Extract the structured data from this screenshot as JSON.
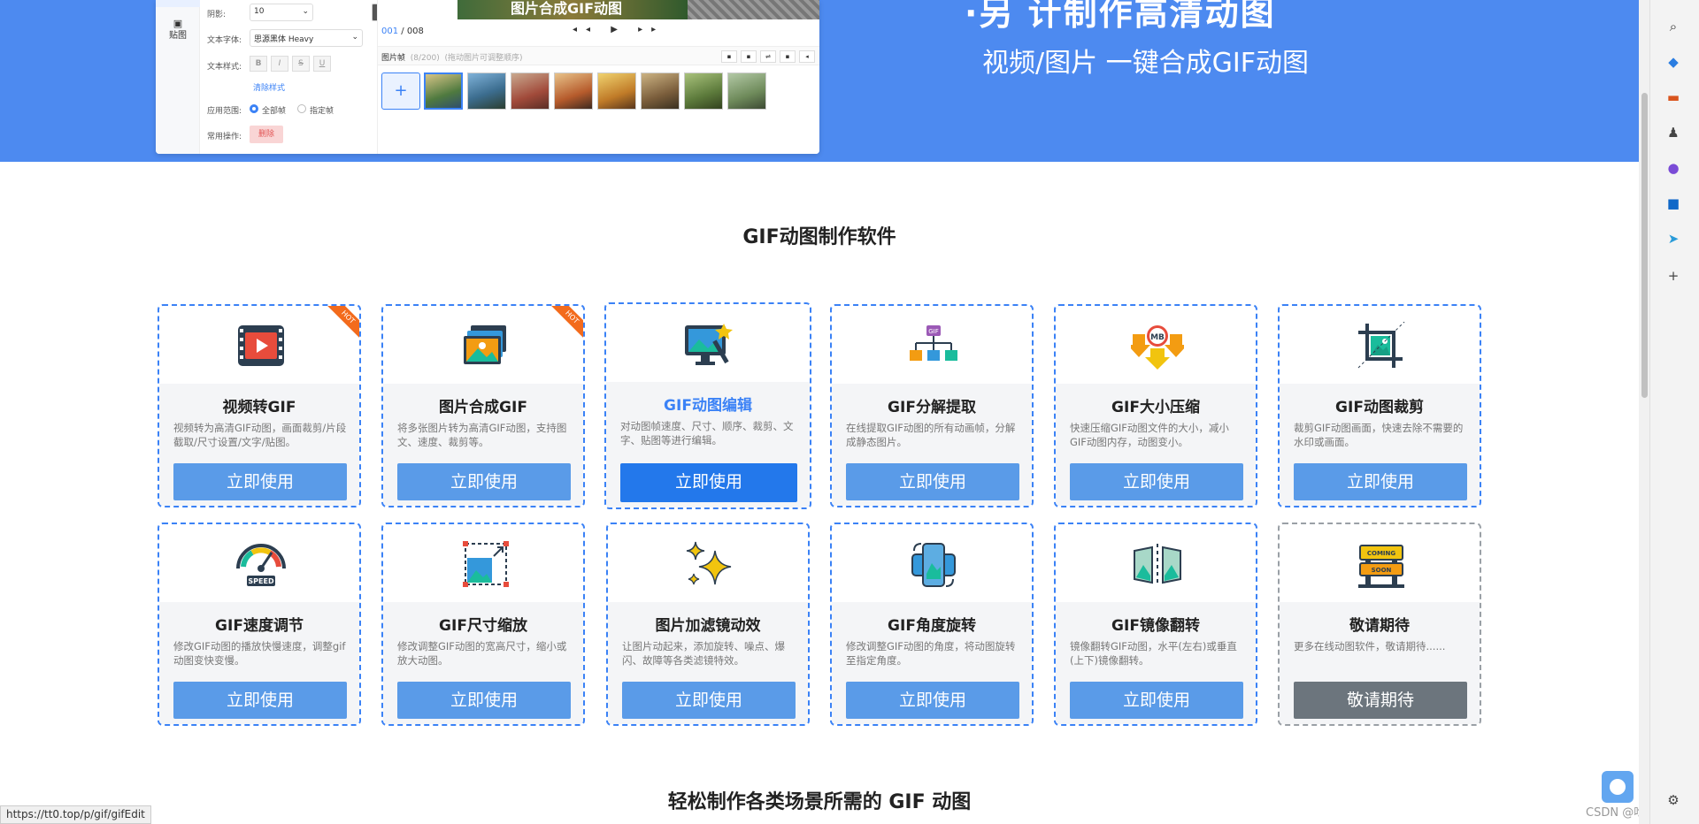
{
  "hero": {
    "title": "·另 计制作高清动图",
    "subtitle": "视频/图片 一键合成GIF动图"
  },
  "editor": {
    "tab_label": "贴图",
    "shadow_label": "阴影:",
    "shadow_value": "10",
    "font_label": "文本字体:",
    "font_value": "思源黑体 Heavy",
    "style_label": "文本样式:",
    "style_buttons": [
      "B",
      "I",
      "S",
      "U"
    ],
    "clear_style": "清除样式",
    "range_label": "应用范围:",
    "range_all": "全部帧",
    "range_some": "指定帧",
    "ops_label": "常用操作:",
    "delete_label": "删除",
    "image_caption": "图片合成GIF动图",
    "frame_current": "001",
    "frame_total": " / 008",
    "controls": "◂◂ ▶ ▸▸",
    "frames_label": "图片帧",
    "frames_count": "(8/200)",
    "frames_hint": "(拖动图片可调整顺序)",
    "add": "+"
  },
  "section1": {
    "title": "GIF动图制作软件"
  },
  "cards": [
    {
      "name": "视频转GIF",
      "desc": "视频转为高清GIF动图，画面裁剪/片段截取/尺寸设置/文字/贴图。",
      "button": "立即使用",
      "badge": "HOT",
      "icon": "video-film-icon"
    },
    {
      "name": "图片合成GIF",
      "desc": "将多张图片转为高清GIF动图，支持图文、速度、裁剪等。",
      "button": "立即使用",
      "badge": "HOT",
      "icon": "photo-stack-icon"
    },
    {
      "name": "GIF动图编辑",
      "desc": "对动图帧速度、尺寸、顺序、裁剪、文字、贴图等进行编辑。",
      "button": "立即使用",
      "badge": "",
      "icon": "monitor-edit-icon"
    },
    {
      "name": "GIF分解提取",
      "desc": "在线提取GIF动图的所有动画帧，分解成静态图片。",
      "button": "立即使用",
      "badge": "",
      "icon": "gif-tree-icon"
    },
    {
      "name": "GIF大小压缩",
      "desc": "快速压缩GIF动图文件的大小，减小GIF动图内存，动图变小。",
      "button": "立即使用",
      "badge": "",
      "icon": "mb-compress-icon"
    },
    {
      "name": "GIF动图裁剪",
      "desc": "裁剪GIF动图画面，快速去除不需要的水印或画面。",
      "button": "立即使用",
      "badge": "",
      "icon": "crop-icon"
    },
    {
      "name": "GIF速度调节",
      "desc": "修改GIF动图的播放快慢速度，调整gif动图变快变慢。",
      "button": "立即使用",
      "badge": "",
      "icon": "speedometer-icon"
    },
    {
      "name": "GIF尺寸缩放",
      "desc": "修改调整GIF动图的宽高尺寸，缩小或放大动图。",
      "button": "立即使用",
      "badge": "",
      "icon": "resize-icon"
    },
    {
      "name": "图片加滤镜动效",
      "desc": "让图片动起来，添加旋转、噪点、爆闪、故障等各类滤镜特效。",
      "button": "立即使用",
      "badge": "",
      "icon": "sparkles-icon"
    },
    {
      "name": "GIF角度旋转",
      "desc": "修改调整GIF动图的角度，将动图旋转至指定角度。",
      "button": "立即使用",
      "badge": "",
      "icon": "rotate-phone-icon"
    },
    {
      "name": "GIF镜像翻转",
      "desc": "镜像翻转GIF动图，水平(左右)或垂直(上下)镜像翻转。",
      "button": "立即使用",
      "badge": "",
      "icon": "mirror-flip-icon"
    },
    {
      "name": "敬请期待",
      "desc": "更多在线动图软件，敬请期待......",
      "button": "敬请期待",
      "badge": "",
      "icon": "coming-soon-sign-icon"
    }
  ],
  "section2": {
    "title": "轻松制作各类场景所需的 GIF 动图"
  },
  "status_url": "https://tt0.top/p/gif/gifEdit",
  "watermark": "CSDN @吃宵夜",
  "sign_text": {
    "coming": "COMING",
    "soon": "SOON"
  },
  "speed_text": "SPEED",
  "gif_text": "GIF",
  "mb_text": "MB",
  "colors": {
    "hero_bg": "#4d8af0",
    "button": "#5a9be8",
    "button_active": "#2378eb",
    "accent": "#3b82f6",
    "gray_button": "#6c757d",
    "hot": "#f36b1c"
  }
}
